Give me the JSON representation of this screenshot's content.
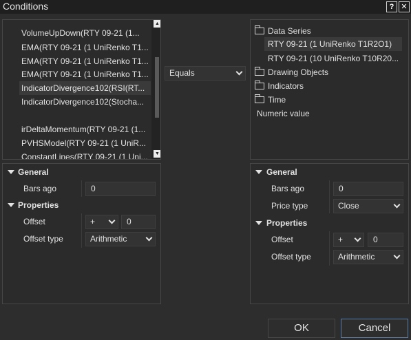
{
  "window": {
    "title": "Conditions",
    "help_label": "?",
    "close_label": "✕"
  },
  "left_list": {
    "items": [
      {
        "label": "VolumeUpDown(RTY 09-21 (1..."
      },
      {
        "label": "EMA(RTY 09-21 (1 UniRenko T1..."
      },
      {
        "label": "EMA(RTY 09-21 (1 UniRenko T1..."
      },
      {
        "label": "EMA(RTY 09-21 (1 UniRenko T1..."
      },
      {
        "label": "IndicatorDivergence102(RSI(RT..."
      },
      {
        "label": "IndicatorDivergence102(Stocha..."
      },
      {
        "label": ""
      },
      {
        "label": "irDeltaMomentum(RTY 09-21 (1..."
      },
      {
        "label": "PVHSModel(RTY 09-21 (1 UniR..."
      },
      {
        "label": "ConstantLines(RTY 09-21 (1 Uni..."
      }
    ],
    "scroll_up_icon": "▲",
    "scroll_down_icon": "▼"
  },
  "operator": {
    "value": "Equals"
  },
  "right_tree": {
    "data_series_label": "Data Series",
    "series": [
      {
        "label": "RTY 09-21 (1 UniRenko T1R2O1)"
      },
      {
        "label": "RTY 09-21 (10 UniRenko T10R20..."
      }
    ],
    "drawing_objects_label": "Drawing Objects",
    "indicators_label": "Indicators",
    "time_label": "Time",
    "numeric_value_label": "Numeric value"
  },
  "left_props": {
    "general_label": "General",
    "bars_ago_label": "Bars ago",
    "bars_ago_value": "0",
    "properties_label": "Properties",
    "offset_label": "Offset",
    "offset_sign": "+",
    "offset_value": "0",
    "offset_type_label": "Offset type",
    "offset_type_value": "Arithmetic"
  },
  "right_props": {
    "general_label": "General",
    "bars_ago_label": "Bars ago",
    "bars_ago_value": "0",
    "price_type_label": "Price type",
    "price_type_value": "Close",
    "properties_label": "Properties",
    "offset_label": "Offset",
    "offset_sign": "+",
    "offset_value": "0",
    "offset_type_label": "Offset type",
    "offset_type_value": "Arithmetic"
  },
  "buttons": {
    "ok_label": "OK",
    "cancel_label": "Cancel"
  }
}
